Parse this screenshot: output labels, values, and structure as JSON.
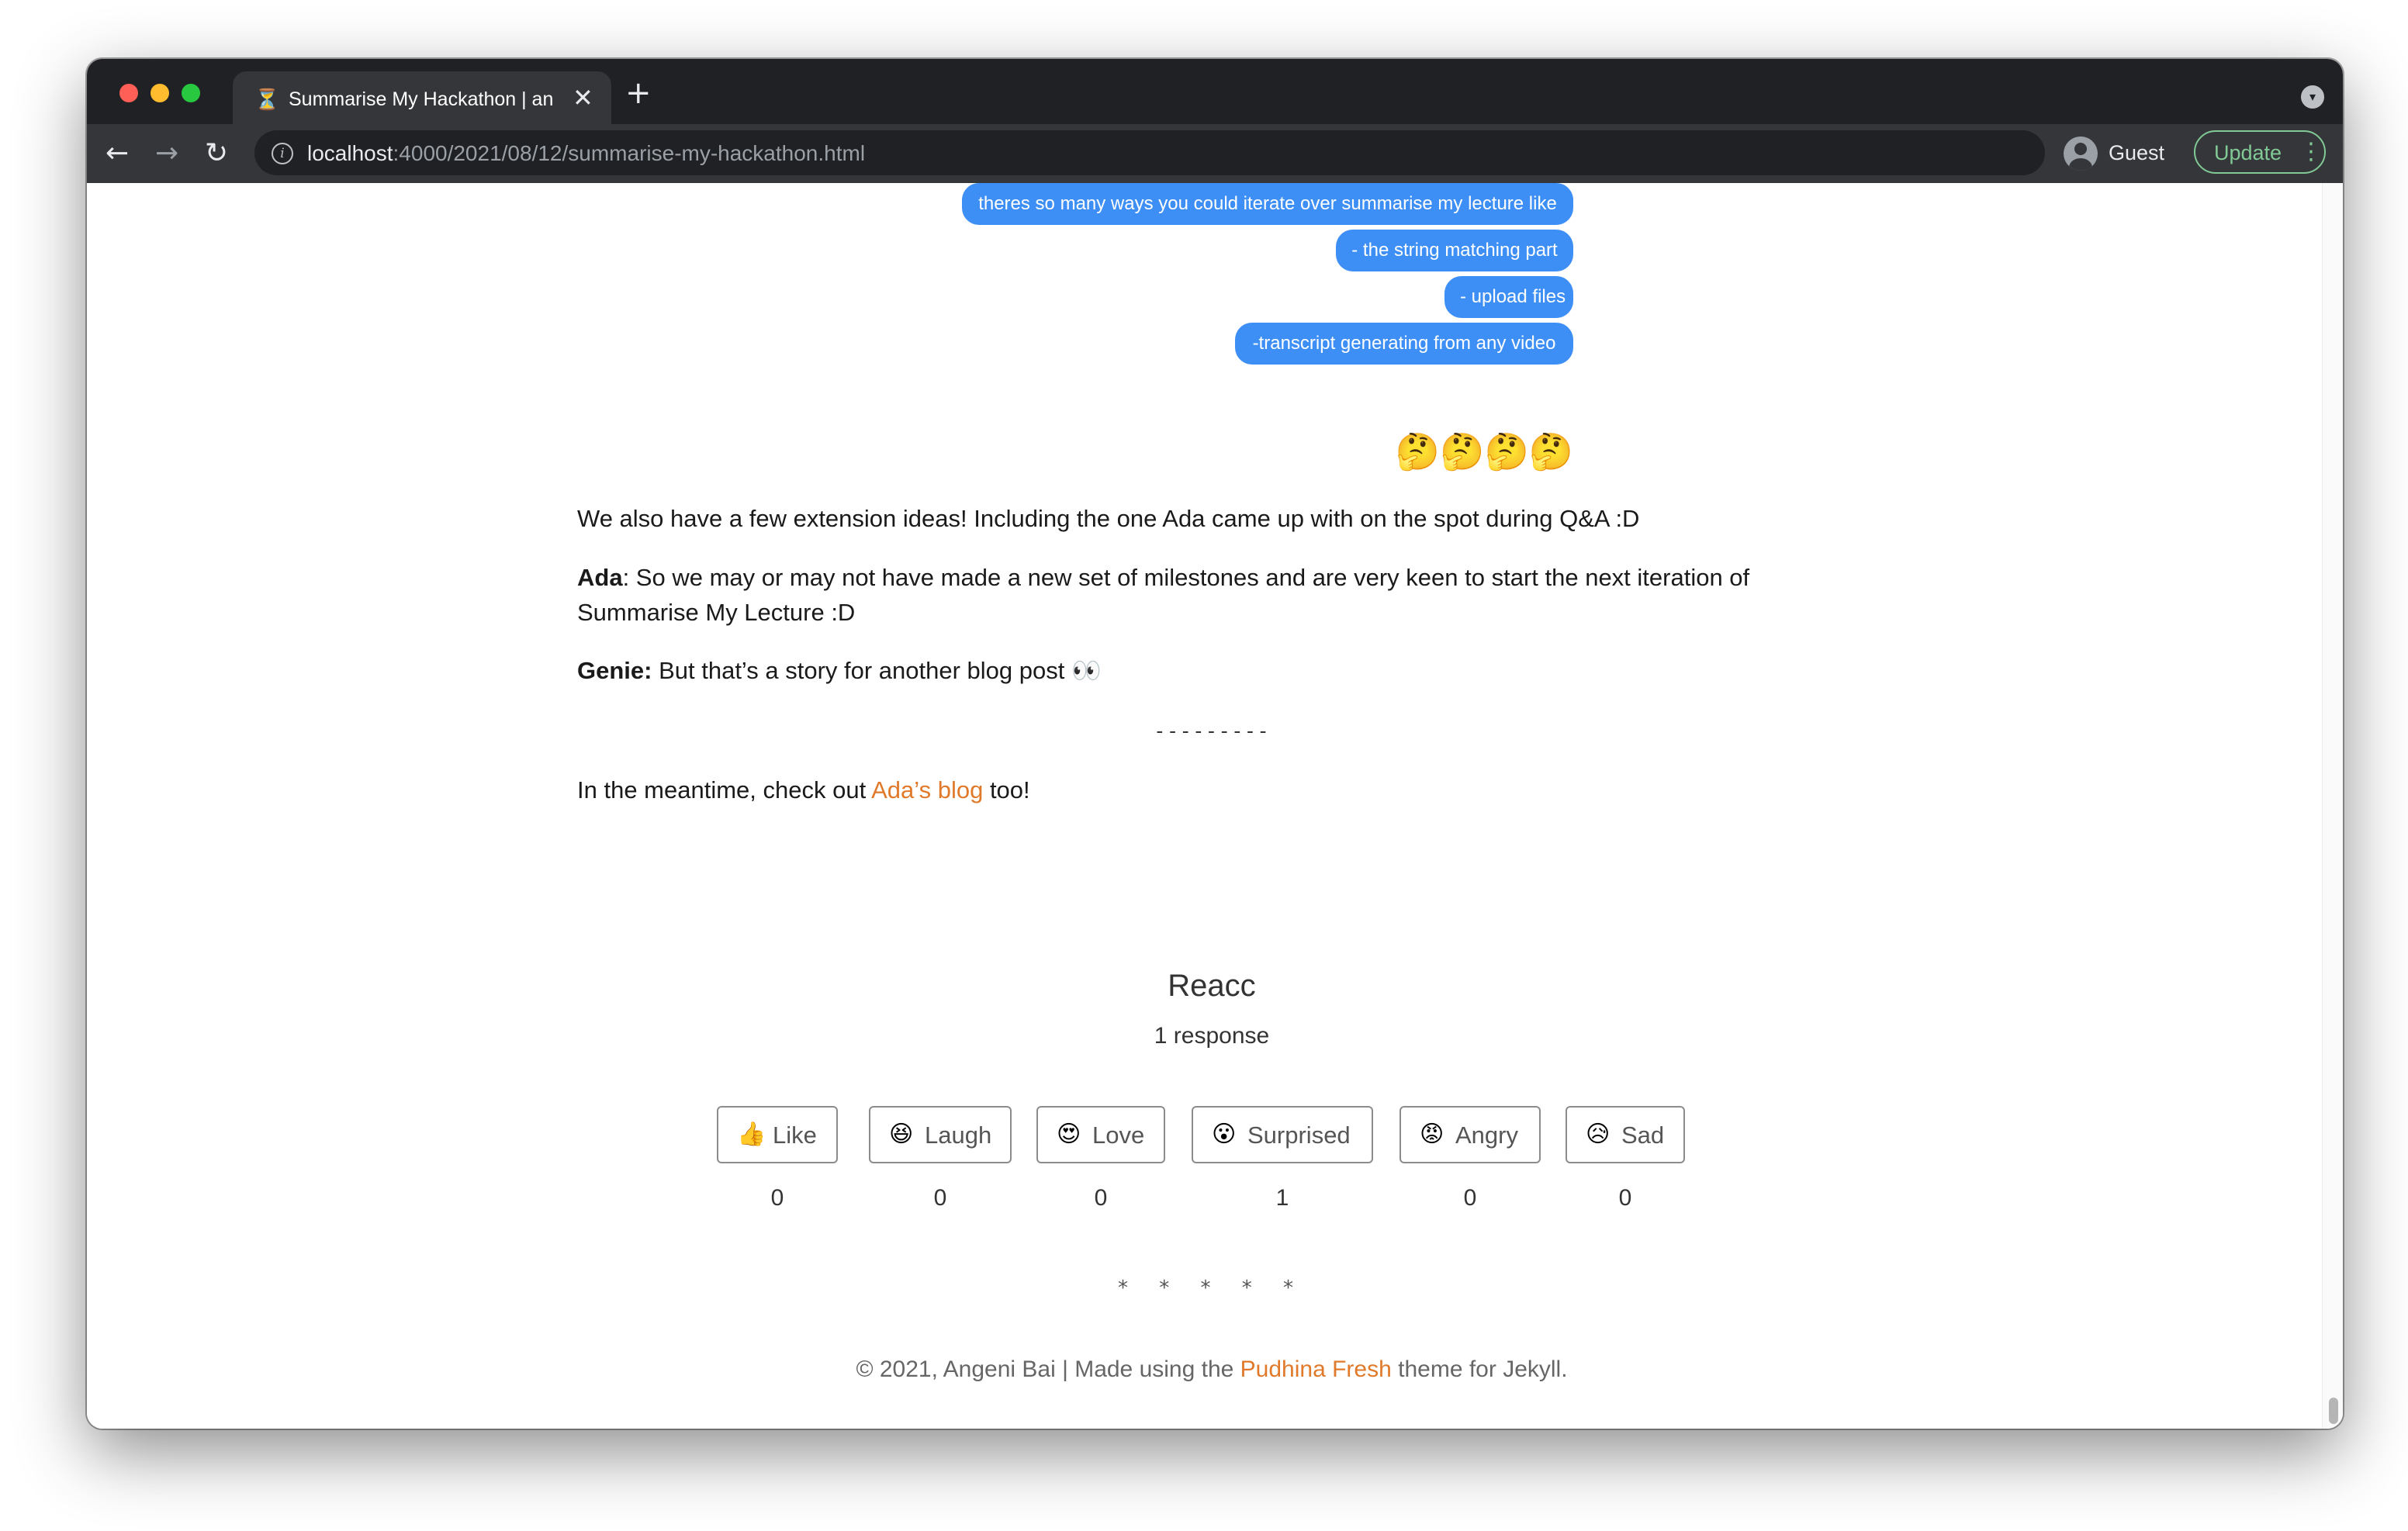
{
  "browser": {
    "tab_title": "Summarise My Hackathon | and",
    "tab_close": "✕",
    "new_tab": "+",
    "url_host": "localhost",
    "url_path": ":4000/2021/08/12/summarise-my-hackathon.html",
    "profile_name": "Guest",
    "update_label": "Update",
    "accent_update": "#81c995"
  },
  "icons": {
    "back": "←",
    "forward": "→",
    "reload": "↻",
    "info": "i",
    "menu": "⋮",
    "dropdown": "▾",
    "favicon": "⏳"
  },
  "chat": {
    "bubbles": [
      "theres so many ways you could iterate over summarise my lecture like",
      "- the string matching part",
      "- upload files",
      "-transcript generating from any video"
    ],
    "emojis": "🤔🤔🤔🤔",
    "bubble_color": "#3d8ff5"
  },
  "article": {
    "p1": "We also have a few extension ideas! Including the one Ada came up with on the spot during Q&A :D",
    "p2_speaker": "Ada",
    "p2_text": ": So we may or may not have made a new set of milestones and are very keen to start the next iteration of Summarise My Lecture :D",
    "p3_speaker": "Genie:",
    "p3_text": " But that’s a story for another blog post 👀",
    "divider": "---------",
    "p4_before": "In the meantime, check out ",
    "p4_link": "Ada’s blog",
    "p4_after": " too!",
    "link_color": "#e07a2a"
  },
  "reactions": {
    "title": "Reacc",
    "count_text": "1 response",
    "items": [
      {
        "emoji": "👍",
        "label": "Like",
        "count": "0"
      },
      {
        "emoji": "😆",
        "label": "Laugh",
        "count": "0"
      },
      {
        "emoji": "😍",
        "label": "Love",
        "count": "0"
      },
      {
        "emoji": "😮",
        "label": "Surprised",
        "count": "1"
      },
      {
        "emoji": "😡",
        "label": "Angry",
        "count": "0"
      },
      {
        "emoji": "😥",
        "label": "Sad",
        "count": "0"
      }
    ]
  },
  "footer": {
    "stars": "* * * * *",
    "before": "© 2021, Angeni Bai | Made using the ",
    "link": "Pudhina Fresh",
    "after": " theme for Jekyll."
  }
}
